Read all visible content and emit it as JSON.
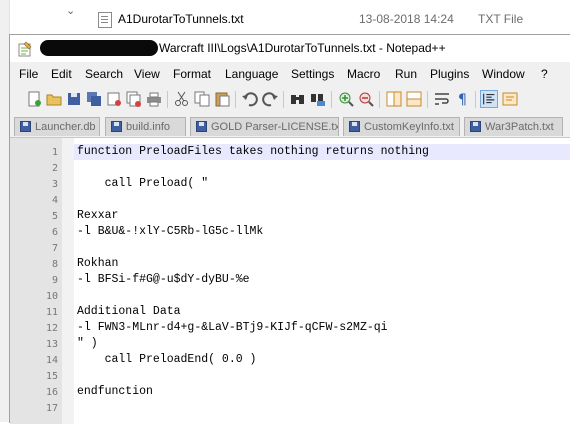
{
  "explorer": {
    "file_name": "A1DurotarToTunnels.txt",
    "file_date": "13-08-2018 14:24",
    "file_type": "TXT File"
  },
  "window": {
    "title": "Warcraft III\\Logs\\A1DurotarToTunnels.txt - Notepad++"
  },
  "menu": [
    "File",
    "Edit",
    "Search",
    "View",
    "Format",
    "Language",
    "Settings",
    "Macro",
    "Run",
    "Plugins",
    "Window",
    "?"
  ],
  "toolbar": [
    "new-file",
    "open-file",
    "save",
    "save-all",
    "close",
    "close-all",
    "print",
    "cut",
    "copy",
    "paste",
    "undo",
    "redo",
    "find",
    "replace",
    "zoom-in",
    "zoom-out",
    "sync-vertical",
    "sync-horizontal",
    "word-wrap",
    "show-all-chars",
    "indent-guide",
    "user-defined-language"
  ],
  "tabs": [
    "Launcher.db",
    "build.info",
    "GOLD Parser-LICENSE.txt",
    "CustomKeyInfo.txt",
    "War3Patch.txt"
  ],
  "lines": [
    {
      "num": "1",
      "text": "function PreloadFiles takes nothing returns nothing"
    },
    {
      "num": "2",
      "text": ""
    },
    {
      "num": "3",
      "text": "    call Preload( \""
    },
    {
      "num": "4",
      "text": ""
    },
    {
      "num": "5",
      "text": "Rexxar"
    },
    {
      "num": "6",
      "text": "-l B&U&-!xlY-C5Rb-lG5c-llMk"
    },
    {
      "num": "7",
      "text": ""
    },
    {
      "num": "8",
      "text": "Rokhan"
    },
    {
      "num": "9",
      "text": "-l BFSi-f#G@-u$dY-dyBU-%e"
    },
    {
      "num": "10",
      "text": ""
    },
    {
      "num": "11",
      "text": "Additional Data"
    },
    {
      "num": "12",
      "text": "-l FWN3-MLnr-d4+g-&LaV-BTj9-KIJf-qCFW-s2MZ-qi"
    },
    {
      "num": "13",
      "text": "\" )"
    },
    {
      "num": "14",
      "text": "    call PreloadEnd( 0.0 )"
    },
    {
      "num": "15",
      "text": ""
    },
    {
      "num": "16",
      "text": "endfunction"
    },
    {
      "num": "17",
      "text": ""
    }
  ]
}
